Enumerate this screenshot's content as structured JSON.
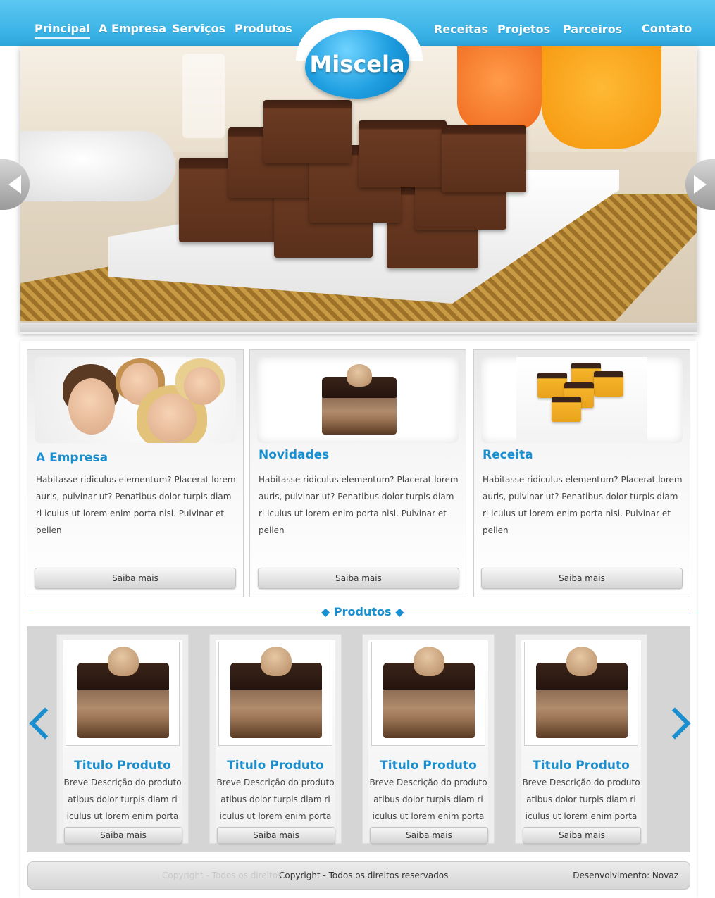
{
  "nav": {
    "left": [
      "Principal",
      "A Empresa",
      "Serviços",
      "Produtos"
    ],
    "right": [
      "Receitas",
      "Projetos",
      "Parceiros",
      "Contato"
    ]
  },
  "logo": {
    "text": "Miscela"
  },
  "colors": {
    "primary": "#1a8fd0",
    "topbar": "#3bb3e6"
  },
  "features": [
    {
      "title": "A Empresa",
      "text": "Habitasse ridiculus elementum? Placerat lorem auris, pulvinar ut? Penatibus dolor turpis diam ri iculus ut lorem enim porta nisi. Pulvinar et pellen",
      "button": "Saiba mais"
    },
    {
      "title": "Novidades",
      "text": "Habitasse ridiculus elementum? Placerat lorem auris, pulvinar ut? Penatibus dolor turpis diam ri iculus ut lorem enim porta nisi. Pulvinar et pellen",
      "button": "Saiba mais"
    },
    {
      "title": "Receita",
      "text": "Habitasse ridiculus elementum? Placerat lorem auris, pulvinar ut? Penatibus dolor turpis diam ri iculus ut lorem enim porta nisi. Pulvinar et pellen",
      "button": "Saiba mais"
    }
  ],
  "products_section": {
    "title": "◆ Produtos ◆"
  },
  "products": [
    {
      "title": "Titulo Produto",
      "desc": "Breve Descrição do produto atibus dolor turpis diam ri iculus ut lorem enim porta",
      "button": "Saiba mais"
    },
    {
      "title": "Titulo Produto",
      "desc": "Breve Descrição do produto atibus dolor turpis diam ri iculus ut lorem enim porta",
      "button": "Saiba mais"
    },
    {
      "title": "Titulo Produto",
      "desc": "Breve Descrição do produto atibus dolor turpis diam ri iculus ut lorem enim porta",
      "button": "Saiba mais"
    },
    {
      "title": "Titulo Produto",
      "desc": "Breve Descrição do produto atibus dolor turpis diam ri iculus ut lorem enim porta",
      "button": "Saiba mais"
    }
  ],
  "footer": {
    "ghost": "Copyright - Todos os direitos",
    "copyright": "Copyright - Todos os direitos reservados",
    "dev": "Desenvolvimento: Novaz"
  }
}
